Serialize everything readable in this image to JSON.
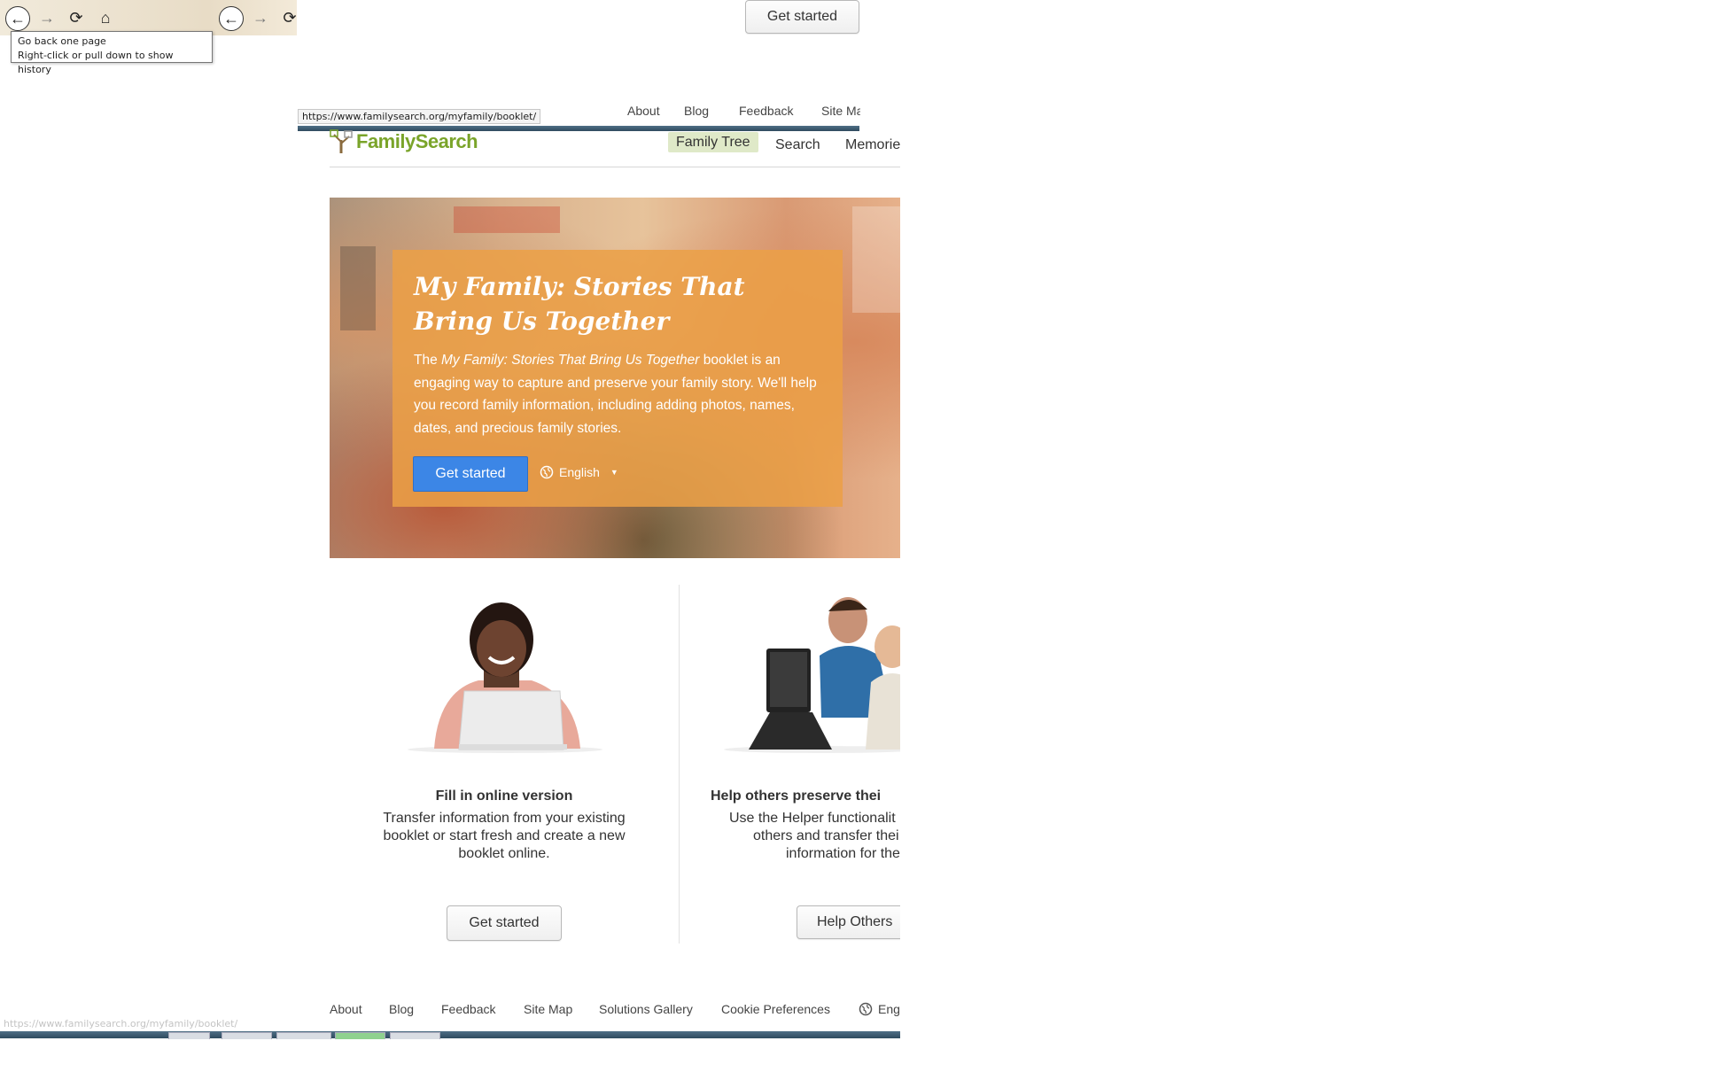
{
  "browser": {
    "tooltip": [
      "Go back one page",
      "Right-click or pull down to show history"
    ],
    "status_url": "https://www.familysearch.org/myfamily/booklet/"
  },
  "floating_get_started": "Get started",
  "top_links": [
    "About",
    "Blog",
    "Feedback",
    "Site Ma"
  ],
  "header": {
    "logo": "FamilySearch",
    "nav": [
      "Family Tree",
      "Search",
      "Memorie"
    ]
  },
  "hero": {
    "title_line1": "My Family: Stories That",
    "title_line2": "Bring Us Together",
    "desc_prefix": "The ",
    "desc_italic": "My Family: Stories That Bring Us Together",
    "desc_suffix": " booklet is an engaging way to capture and preserve your family story. We'll help you record family information, including adding photos, names, dates, and precious family stories.",
    "button": "Get started",
    "language": "English"
  },
  "columns": [
    {
      "title": "Fill in online version",
      "desc_lines": [
        "Transfer information from your existing",
        "booklet or start fresh and create a new",
        "booklet online."
      ],
      "button": "Get started"
    },
    {
      "title": "Help others preserve thei",
      "desc_lines": [
        "Use the Helper functionalit",
        "others and transfer thei",
        "information for the"
      ],
      "button": "Help Others"
    }
  ],
  "footer": {
    "links": [
      "About",
      "Blog",
      "Feedback",
      "Site Map",
      "Solutions Gallery",
      "Cookie Preferences"
    ],
    "language": "Eng",
    "status_url": "https://www.familysearch.org/myfamily/booklet/"
  },
  "colors": {
    "brand_green": "#7aa42a",
    "hero_card": "#eba046",
    "primary_button": "#3c86e6",
    "active_nav_bg": "#dfe9c8"
  }
}
